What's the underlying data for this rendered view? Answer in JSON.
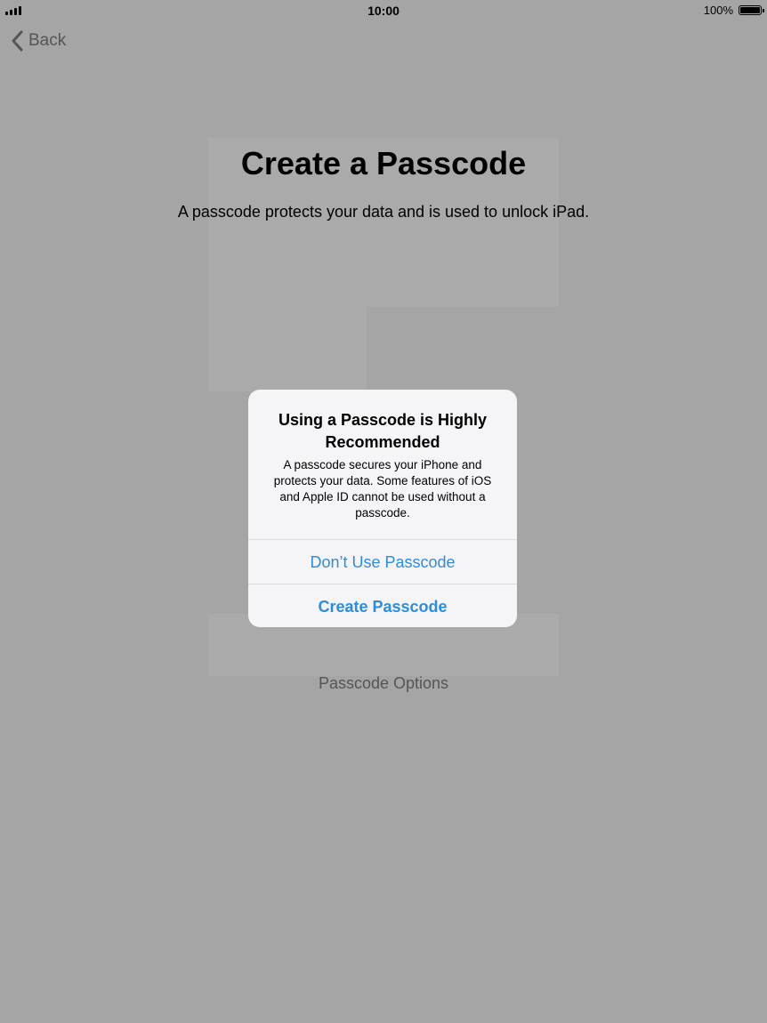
{
  "status_bar": {
    "time": "10:00",
    "battery_percent": "100%"
  },
  "nav": {
    "back_label": "Back"
  },
  "page": {
    "title": "Create a Passcode",
    "subtitle": "A passcode protects your data and is used to unlock iPad.",
    "options_label": "Passcode Options"
  },
  "alert": {
    "title": "Using a Passcode is Highly Recommended",
    "message": "A passcode secures your iPhone and protects your data. Some features of iOS and Apple ID cannot be used without a passcode.",
    "dont_use_label": "Don’t Use Passcode",
    "create_label": "Create Passcode"
  },
  "colors": {
    "accent": "#2d8ddb",
    "dim_background": "#a5a5a5"
  }
}
